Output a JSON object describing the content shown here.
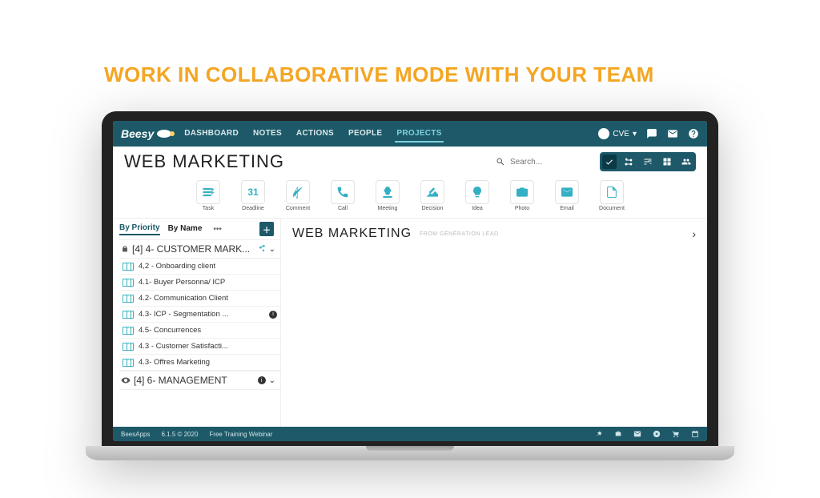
{
  "hero": {
    "title": "WORK IN COLLABORATIVE MODE WITH YOUR TEAM"
  },
  "brand": "Beesy",
  "nav": {
    "items": [
      {
        "label": "DASHBOARD"
      },
      {
        "label": "NOTES"
      },
      {
        "label": "ACTIONS"
      },
      {
        "label": "PEOPLE"
      },
      {
        "label": "PROJECTS",
        "active": true
      }
    ],
    "user": "CVE"
  },
  "page": {
    "title": "WEB MARKETING"
  },
  "search": {
    "placeholder": "Search..."
  },
  "actions": [
    {
      "key": "task",
      "label": "Task"
    },
    {
      "key": "deadline",
      "label": "Deadline",
      "text": "31"
    },
    {
      "key": "comment",
      "label": "Comment"
    },
    {
      "key": "call",
      "label": "Call"
    },
    {
      "key": "meeting",
      "label": "Meeting"
    },
    {
      "key": "decision",
      "label": "Decision"
    },
    {
      "key": "idea",
      "label": "Idea"
    },
    {
      "key": "photo",
      "label": "Photo"
    },
    {
      "key": "email",
      "label": "Email"
    },
    {
      "key": "document",
      "label": "Document"
    }
  ],
  "sidebar": {
    "tabs": [
      {
        "label": "By Priority",
        "active": true
      },
      {
        "label": "By Name"
      }
    ],
    "groups": [
      {
        "icon": "lock",
        "title": "[4] 4- CUSTOMER MARK...",
        "items": [
          {
            "label": "4,2 - Onboarding client"
          },
          {
            "label": "4.1- Buyer Personna/ ICP"
          },
          {
            "label": "4.2- Communication Client"
          },
          {
            "label": "4.3- ICP - Segmentation ...",
            "info": true
          },
          {
            "label": "4.5- Concurrences"
          },
          {
            "label": "4.3 - Customer Satisfacti..."
          },
          {
            "label": "4.3- Offres Marketing"
          }
        ]
      },
      {
        "icon": "eye",
        "title": "[4] 6- MANAGEMENT",
        "items": []
      }
    ]
  },
  "section": {
    "title": "WEB MARKETING",
    "sub": "FROM GÉNÉRATION LEAD"
  },
  "footer": {
    "brand": "BeesApps",
    "version": "6.1.5 © 2020",
    "link": "Free Training Webinar"
  }
}
